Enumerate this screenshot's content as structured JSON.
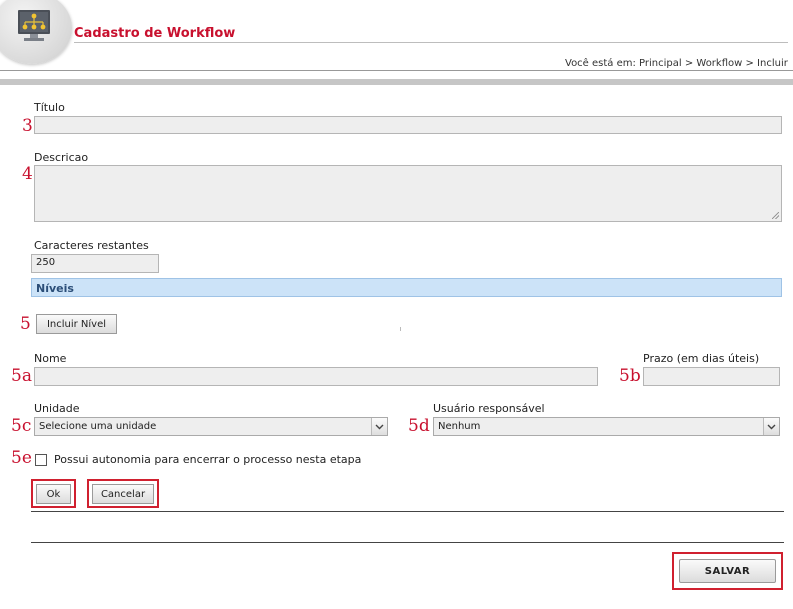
{
  "header": {
    "title": "Cadastro de Workflow",
    "breadcrumb": "Você está em: Principal > Workflow > Incluir"
  },
  "form": {
    "titulo_label": "Título",
    "titulo_value": "",
    "descricao_label": "Descricao",
    "descricao_value": "",
    "chars_label": "Caracteres restantes",
    "chars_value": "250"
  },
  "niveis": {
    "section_title": "Níveis",
    "add_button": "Incluir Nível",
    "nome_label": "Nome",
    "nome_value": "",
    "prazo_label": "Prazo (em dias úteis)",
    "prazo_value": "",
    "unidade_label": "Unidade",
    "unidade_selected": "Selecione uma unidade",
    "usuario_label": "Usuário responsável",
    "usuario_selected": "Nenhum",
    "autonomia_label": "Possui autonomia para encerrar o processo nesta etapa",
    "autonomia_checked": false,
    "ok_button": "Ok",
    "cancel_button": "Cancelar"
  },
  "footer": {
    "save_button": "SALVAR"
  },
  "annotations": {
    "a3": "3",
    "a4": "4",
    "a5": "5",
    "a5a": "5a",
    "a5b": "5b",
    "a5c": "5c",
    "a5d": "5d",
    "a5e": "5e"
  },
  "colors": {
    "title_red": "#c8102e",
    "annotation_red": "#c8102e",
    "highlight_box": "#d0202f",
    "section_bar": "#cce3f8",
    "section_text": "#2b4e78"
  },
  "icons": {
    "logo": "workflow-monitor-icon",
    "select_arrow": "chevron-down-icon",
    "resize": "resize-grip-icon"
  }
}
